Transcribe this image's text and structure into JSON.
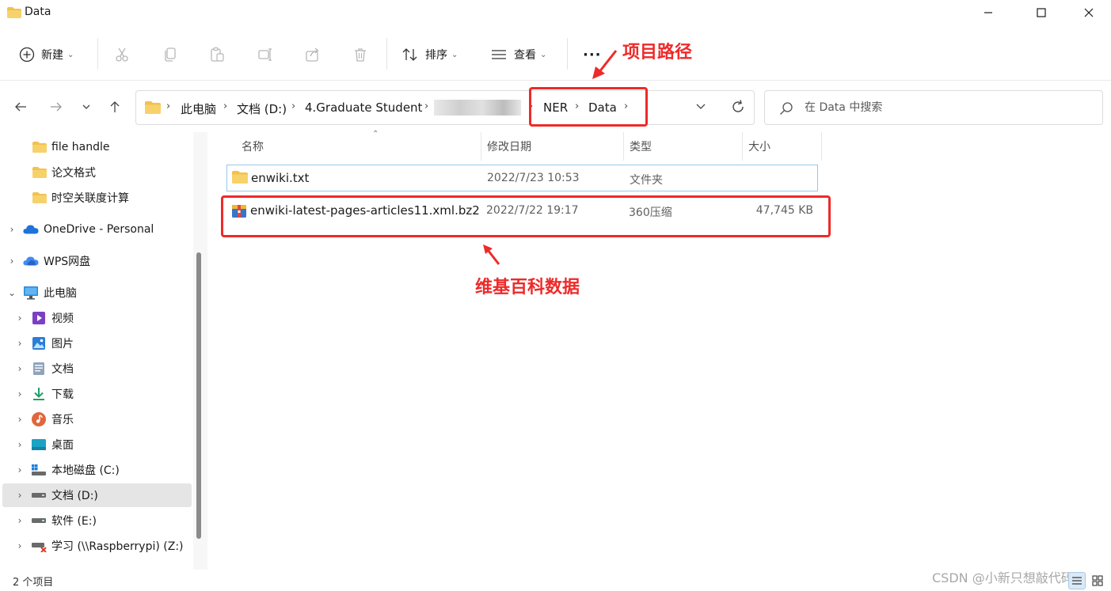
{
  "window": {
    "title": "Data",
    "minimize": "—",
    "maximize": "☐",
    "close": "✕"
  },
  "toolbar": {
    "new_label": "新建",
    "sort_label": "排序",
    "view_label": "查看",
    "more_label": "···"
  },
  "address": {
    "crumbs": [
      "此电脑",
      "文档 (D:)",
      "4.Graduate Student",
      "NER",
      "Data"
    ],
    "search_placeholder": "在 Data 中搜索"
  },
  "annotations": {
    "project_path": "项目路径",
    "wiki_data": "维基百科数据"
  },
  "sidebar": {
    "items": [
      {
        "label": "file handle",
        "icon": "folder-icon"
      },
      {
        "label": "论文格式",
        "icon": "folder-icon"
      },
      {
        "label": "时空关联度计算",
        "icon": "folder-icon"
      },
      {
        "label": "OneDrive - Personal",
        "icon": "cloud-icon"
      },
      {
        "label": "WPS网盘",
        "icon": "wps-cloud-icon"
      },
      {
        "label": "此电脑",
        "icon": "computer-icon"
      },
      {
        "label": "视频",
        "icon": "video-icon"
      },
      {
        "label": "图片",
        "icon": "picture-icon"
      },
      {
        "label": "文档",
        "icon": "document-icon"
      },
      {
        "label": "下载",
        "icon": "download-icon"
      },
      {
        "label": "音乐",
        "icon": "music-icon"
      },
      {
        "label": "桌面",
        "icon": "desktop-icon"
      },
      {
        "label": "本地磁盘 (C:)",
        "icon": "drive-c-icon"
      },
      {
        "label": "文档 (D:)",
        "icon": "drive-icon"
      },
      {
        "label": "软件 (E:)",
        "icon": "drive-icon"
      },
      {
        "label": "学习 (\\\\Raspberrypi) (Z:)",
        "icon": "network-drive-icon"
      }
    ]
  },
  "columns": {
    "name": "名称",
    "modified": "修改日期",
    "type": "类型",
    "size": "大小"
  },
  "files": [
    {
      "name": "enwiki.txt",
      "modified": "2022/7/23 10:53",
      "type": "文件夹",
      "size": ""
    },
    {
      "name": "enwiki-latest-pages-articles11.xml.bz2",
      "modified": "2022/7/22 19:17",
      "type": "360压缩",
      "size": "47,745 KB"
    }
  ],
  "status": {
    "count": "2 个项目",
    "watermark": "CSDN @小新只想敲代码"
  },
  "colors": {
    "annotation_red": "#ee2a2a",
    "folder_yellow": "#f2c14e",
    "selection_blue": "#99c8e8"
  }
}
